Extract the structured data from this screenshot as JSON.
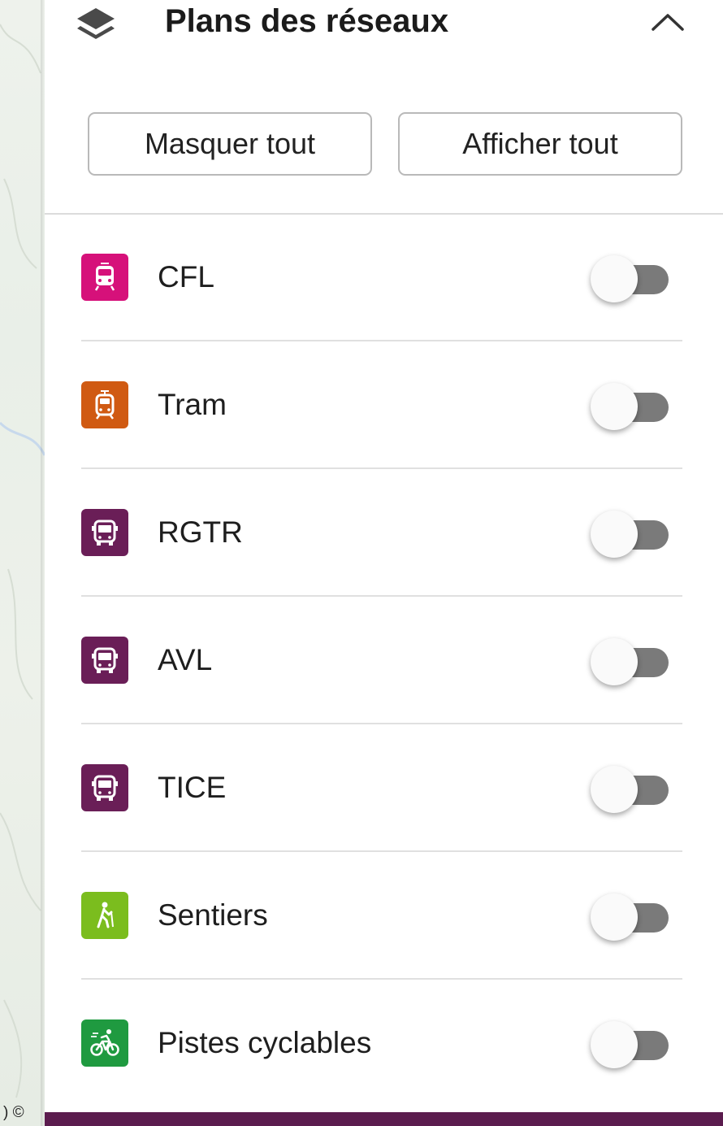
{
  "header": {
    "title": "Plans des réseaux",
    "layers_icon": "layers-icon",
    "collapse_icon": "chevron-up-icon"
  },
  "actions": {
    "hide_all_label": "Masquer tout",
    "show_all_label": "Afficher tout"
  },
  "networks": [
    {
      "label": "CFL",
      "icon": "train-icon",
      "color": "#d6117a",
      "enabled": false
    },
    {
      "label": "Tram",
      "icon": "tram-icon",
      "color": "#d05a12",
      "enabled": false
    },
    {
      "label": "RGTR",
      "icon": "bus-icon",
      "color": "#6a1e57",
      "enabled": false
    },
    {
      "label": "AVL",
      "icon": "bus-icon",
      "color": "#6a1e57",
      "enabled": false
    },
    {
      "label": "TICE",
      "icon": "bus-icon",
      "color": "#6a1e57",
      "enabled": false
    },
    {
      "label": "Sentiers",
      "icon": "hiker-icon",
      "color": "#7bbd1e",
      "enabled": false
    },
    {
      "label": "Pistes cyclables",
      "icon": "bicycle-icon",
      "color": "#1f9a40",
      "enabled": false
    }
  ],
  "map": {
    "attribution": ") ©"
  },
  "colors": {
    "bottom_bar": "#5b1c4e",
    "toggle_track_off": "#7a7a7a"
  }
}
